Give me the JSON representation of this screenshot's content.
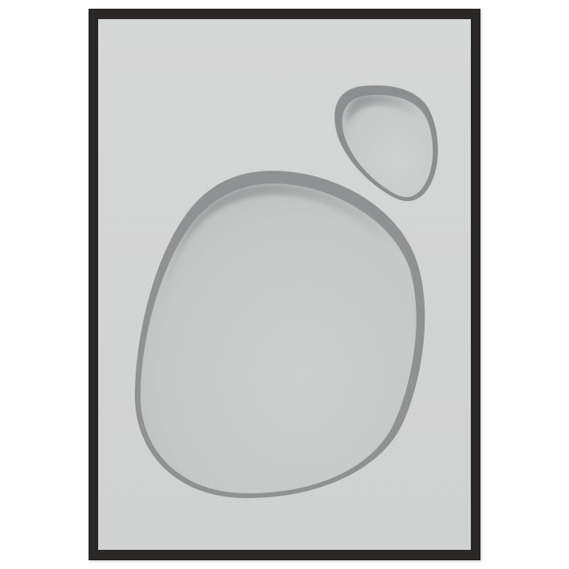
{
  "artwork": {
    "subject": "framed-relief-print",
    "frame_color": "#2a2827",
    "paper_color": "#d2d3d3",
    "cutout_color": "#c9cbcb",
    "shadow_color": "#8e9091"
  }
}
